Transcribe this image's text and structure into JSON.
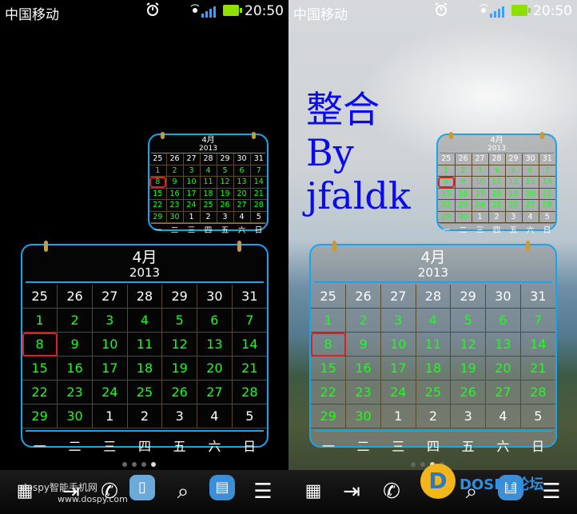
{
  "status": {
    "carrier": "中国移动",
    "time": "20:50"
  },
  "calendar": {
    "month": "4月",
    "year": "2013",
    "weeks": [
      [
        "25",
        "26",
        "27",
        "28",
        "29",
        "30",
        "31"
      ],
      [
        "1",
        "2",
        "3",
        "4",
        "5",
        "6",
        "7"
      ],
      [
        "8",
        "9",
        "10",
        "11",
        "12",
        "13",
        "14"
      ],
      [
        "15",
        "16",
        "17",
        "18",
        "19",
        "20",
        "21"
      ],
      [
        "22",
        "23",
        "24",
        "25",
        "26",
        "27",
        "28"
      ],
      [
        "29",
        "30",
        "1",
        "2",
        "3",
        "4",
        "5"
      ]
    ],
    "weekdays": [
      "一",
      "二",
      "三",
      "四",
      "五",
      "六",
      "日"
    ],
    "today": "8"
  },
  "overlay": {
    "line1": "整合",
    "line2": "By",
    "line3": "jfaldk"
  },
  "watermarks": {
    "left": "dospy智能手机网",
    "left_url": "www.dospy.com",
    "right": "DOSPY论坛"
  },
  "colors": {
    "accent": "#1aa4ec",
    "day": "#19ff19",
    "today_outline": "#e02020"
  },
  "dock_icons": [
    "apps-icon",
    "switch-icon",
    "phone-icon",
    "search-icon",
    "menu-icon"
  ]
}
